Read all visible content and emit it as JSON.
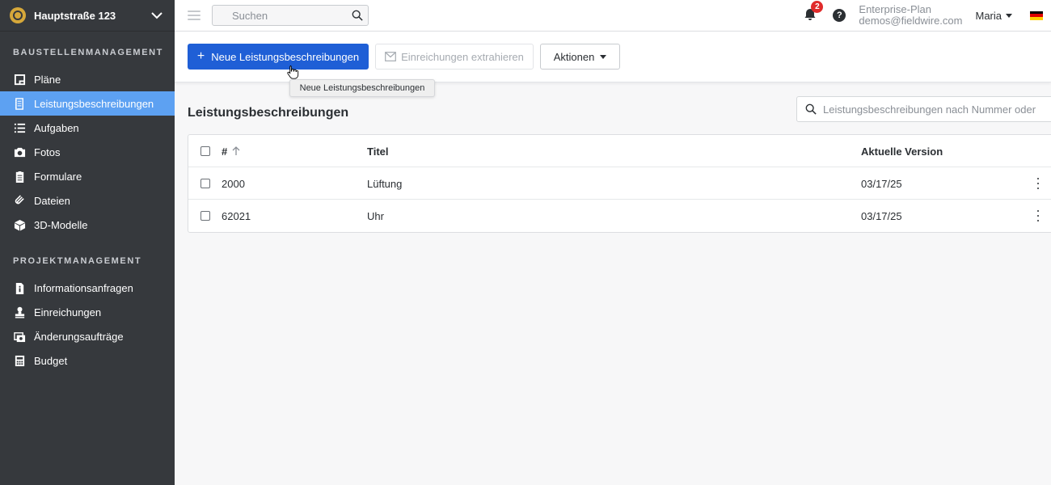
{
  "project": {
    "name": "Hauptstraße 123"
  },
  "sidebar": {
    "section1": "BAUSTELLENMANAGEMENT",
    "section2": "PROJEKTMANAGEMENT",
    "items1": [
      {
        "label": "Pläne",
        "icon": "plans-icon"
      },
      {
        "label": "Leistungsbeschreibungen",
        "icon": "specifications-icon",
        "active": true
      },
      {
        "label": "Aufgaben",
        "icon": "tasks-list-icon"
      },
      {
        "label": "Fotos",
        "icon": "camera-icon"
      },
      {
        "label": "Formulare",
        "icon": "clipboard-icon"
      },
      {
        "label": "Dateien",
        "icon": "paperclip-icon"
      },
      {
        "label": "3D-Modelle",
        "icon": "cube-icon"
      }
    ],
    "items2": [
      {
        "label": "Informationsanfragen",
        "icon": "info-document-icon"
      },
      {
        "label": "Einreichungen",
        "icon": "stamp-icon"
      },
      {
        "label": "Änderungsaufträge",
        "icon": "change-order-icon"
      },
      {
        "label": "Budget",
        "icon": "calculator-icon"
      }
    ]
  },
  "topbar": {
    "search_placeholder": "Suchen",
    "notifications_count": "2",
    "help_glyph": "?",
    "plan_name": "Enterprise-Plan",
    "email": "demos@fieldwire.com",
    "user_name": "Maria"
  },
  "toolbar": {
    "new_button": "Neue Leistungsbeschreibungen",
    "extract_button": "Einreichungen extrahieren",
    "actions_button": "Aktionen",
    "tooltip": "Neue Leistungsbeschreibungen"
  },
  "main": {
    "title": "Leistungsbeschreibungen",
    "search_placeholder": "Leistungsbeschreibungen nach Nummer oder"
  },
  "table": {
    "columns": {
      "number": "#",
      "title": "Titel",
      "version": "Aktuelle Version"
    },
    "rows": [
      {
        "number": "2000",
        "title": "Lüftung",
        "version": "03/17/25"
      },
      {
        "number": "62021",
        "title": "Uhr",
        "version": "03/17/25"
      }
    ]
  },
  "colors": {
    "sidebar_bg": "#36393d",
    "active_item": "#5da1f2",
    "primary_button": "#1f5fd6",
    "badge": "#e02b2b"
  }
}
